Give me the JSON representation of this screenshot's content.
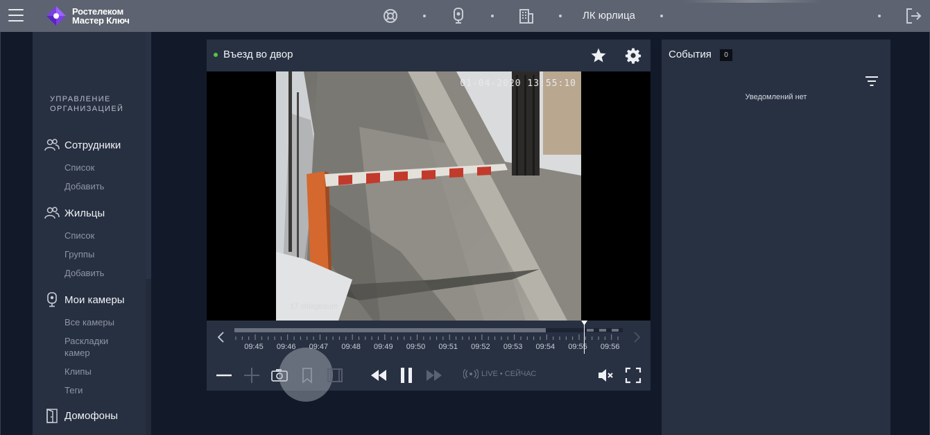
{
  "header": {
    "brand_line1": "Ростелеком",
    "brand_line2": "Мастер Ключ",
    "company": "ЛК юрлица",
    "icons": [
      "menu-icon",
      "support-icon",
      "intercom-camera-icon",
      "building-icon",
      "logout-icon"
    ]
  },
  "sidebar": {
    "section_title": "УПРАВЛЕНИЕ ОРГАНИЗАЦИЕЙ",
    "groups": [
      {
        "label": "Сотрудники",
        "icon": "people-icon",
        "items": [
          "Список",
          "Добавить"
        ]
      },
      {
        "label": "Жильцы",
        "icon": "people-icon",
        "items": [
          "Список",
          "Группы",
          "Добавить"
        ]
      },
      {
        "label": "Мои камеры",
        "icon": "camera-icon",
        "items": [
          "Все камеры",
          "Раскладки камер",
          "Клипы",
          "Теги"
        ]
      },
      {
        "label": "Домофоны",
        "icon": "door-icon",
        "items": []
      }
    ]
  },
  "camera": {
    "title": "Въезд во двор",
    "status_color": "#57c443",
    "timestamp": "01-04-2020 13:55:10",
    "overlay_label": "17 shlagbaum",
    "timeline_labels": [
      "09:45",
      "09:46",
      "09:47",
      "09:48",
      "09:49",
      "09:50",
      "09:51",
      "09:52",
      "09:53",
      "09:54",
      "09:55",
      "09:56"
    ],
    "live_label": "LIVE • СЕЙЧАС"
  },
  "events": {
    "title": "События",
    "count": "0",
    "empty_text": "Уведомлений нет"
  },
  "colors": {
    "topbar": "#5d6370",
    "panel": "#283142",
    "background": "#121a2a",
    "accent_green": "#57c443",
    "brand_purple": "#7b3fe4"
  }
}
